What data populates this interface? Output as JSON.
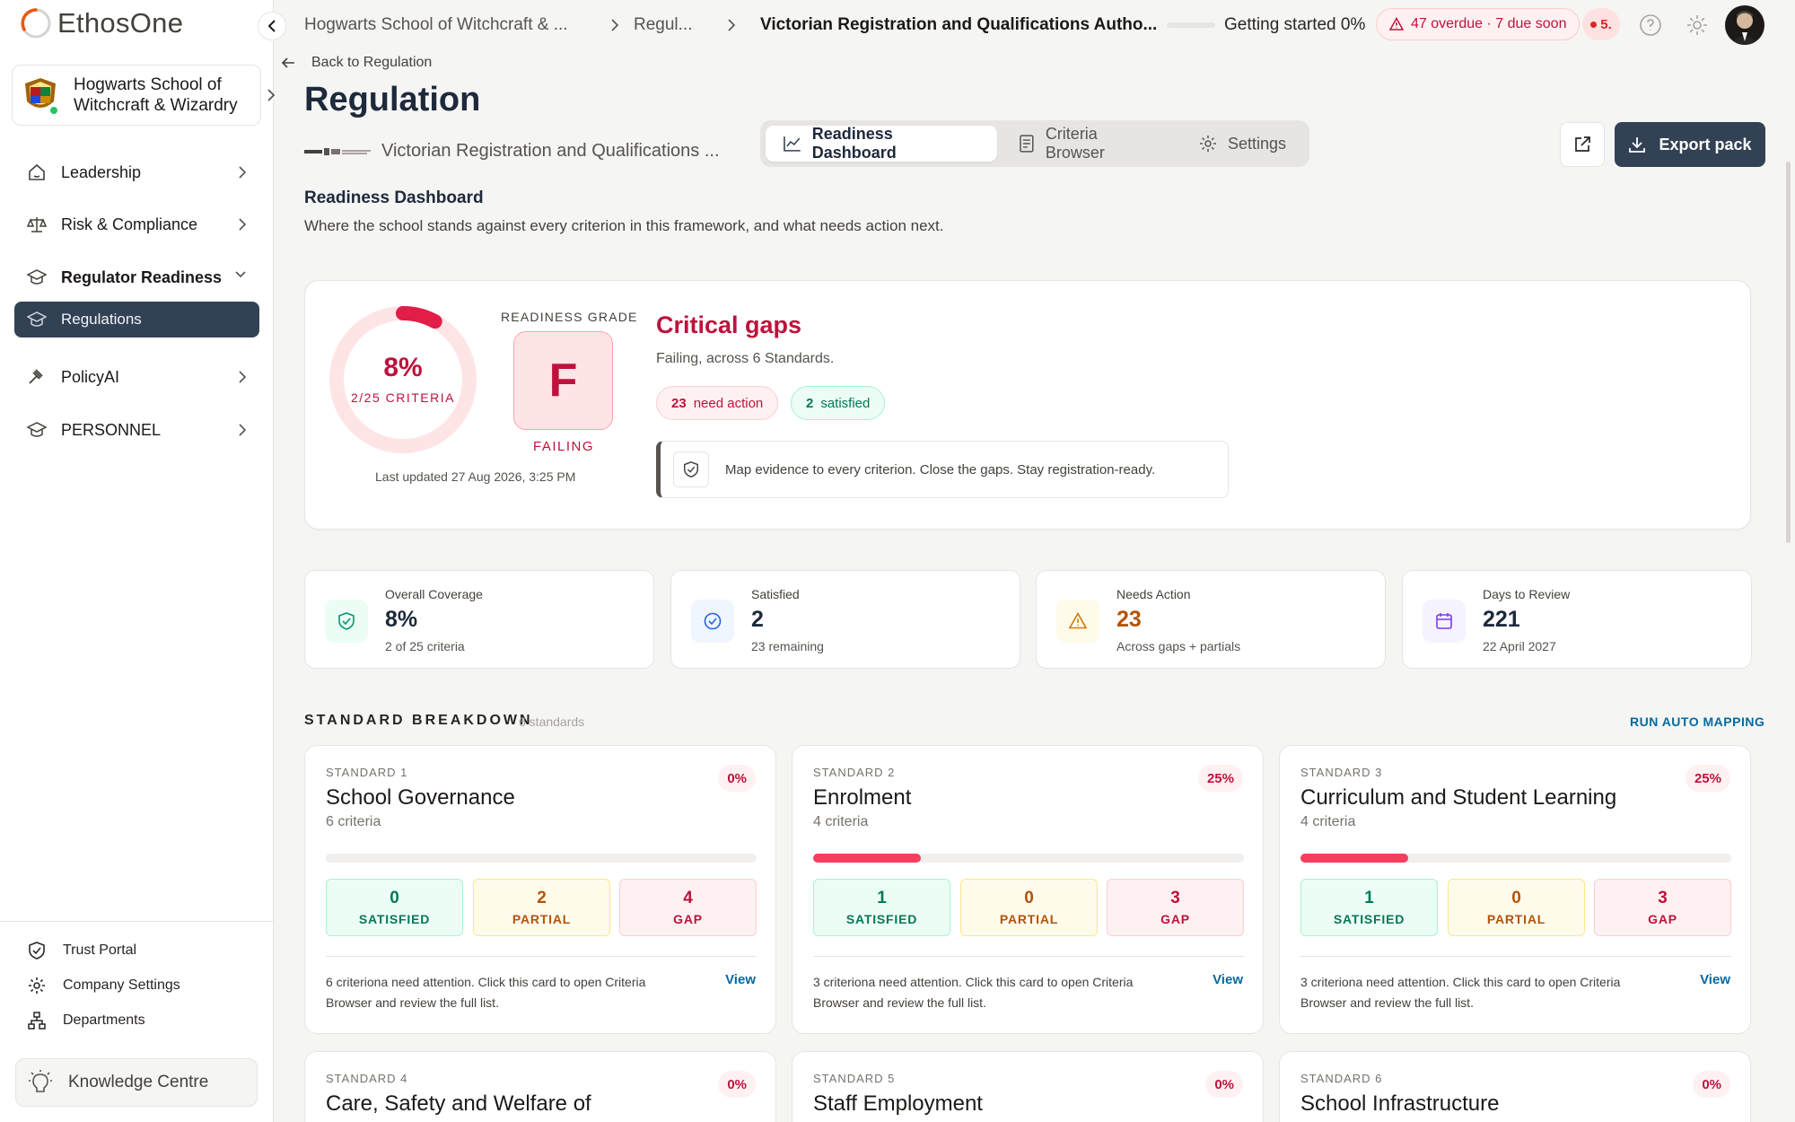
{
  "app": {
    "logo_text": "EthosOne"
  },
  "sidebar": {
    "org_name_line1": "Hogwarts School of",
    "org_name_line2": "Witchcraft & Wizardry",
    "items": [
      {
        "label": "Leadership",
        "icon": "house-icon"
      },
      {
        "label": "Risk & Compliance",
        "icon": "scales-icon"
      },
      {
        "label": "Regulator Readiness",
        "icon": "graduation-cap-icon"
      },
      {
        "label": "Regulations",
        "icon": "graduation-cap-icon"
      },
      {
        "label": "PolicyAI",
        "icon": "gavel-icon"
      },
      {
        "label": "PERSONNEL",
        "icon": "graduation-cap-icon"
      }
    ],
    "footer": [
      {
        "label": "Trust Portal",
        "icon": "shield-check-icon"
      },
      {
        "label": "Company Settings",
        "icon": "gear-icon"
      },
      {
        "label": "Departments",
        "icon": "org-chart-icon"
      }
    ],
    "knowledge_centre": "Knowledge Centre"
  },
  "topbar": {
    "crumb1": "Hogwarts School of Witchcraft & ...",
    "crumb2": "Regul...",
    "crumb3": "Victorian Registration and Qualifications Autho...",
    "getting_started": "Getting started 0%",
    "overdue": "47 overdue · 7 due soon",
    "alerts": "5."
  },
  "header": {
    "back": "Back to Regulation",
    "title": "Regulation",
    "regulator": "Victorian Registration and Qualifications ...",
    "tabs": [
      "Readiness Dashboard",
      "Criteria Browser",
      "Settings"
    ],
    "export": "Export pack"
  },
  "readiness": {
    "title": "Readiness Dashboard",
    "description": "Where the school stands against every criterion in this framework, and what needs action next.",
    "percent": "8%",
    "percent_value": 8,
    "criteria": "2/25 CRITERIA",
    "updated": "Last updated 27 Aug 2026, 3:25 PM",
    "grade_label": "READINESS GRADE",
    "grade": "F",
    "grade_status": "FAILING",
    "headline": "Critical gaps",
    "subline": "Failing, across 6 Standards.",
    "need_action_count": "23",
    "need_action_label": "need action",
    "satisfied_count": "2",
    "satisfied_label": "satisfied",
    "tagline": "Map evidence to every criterion. Close the gaps. Stay registration-ready."
  },
  "stats": [
    {
      "label": "Overall Coverage",
      "value": "8%",
      "note": "2 of 25 criteria",
      "icon": "shield-check-icon"
    },
    {
      "label": "Satisfied",
      "value": "2",
      "note": "23 remaining",
      "icon": "check-circle-icon"
    },
    {
      "label": "Needs Action",
      "value": "23",
      "note": "Across gaps + partials",
      "icon": "warning-icon"
    },
    {
      "label": "Days to Review",
      "value": "221",
      "note": "22 April 2027",
      "icon": "calendar-icon"
    }
  ],
  "standards_section": {
    "title": "STANDARD BREAKDOWN",
    "count": "6 standards",
    "run": "RUN AUTO MAPPING",
    "satisfied_label": "SATISFIED",
    "partial_label": "PARTIAL",
    "gap_label": "GAP",
    "view_label": "View"
  },
  "standards": [
    {
      "num": "STANDARD 1",
      "name": "School Governance",
      "criteria": "6 criteria",
      "pct": "0%",
      "progress": 0,
      "satisfied": "0",
      "partial": "2",
      "gap": "4",
      "msg": "6 criteriona need attention. Click this card to open Criteria Browser and review the full list."
    },
    {
      "num": "STANDARD 2",
      "name": "Enrolment",
      "criteria": "4 criteria",
      "pct": "25%",
      "progress": 25,
      "satisfied": "1",
      "partial": "0",
      "gap": "3",
      "msg": "3 criteriona need attention. Click this card to open Criteria Browser and review the full list."
    },
    {
      "num": "STANDARD 3",
      "name": "Curriculum and Student Learning",
      "criteria": "4 criteria",
      "pct": "25%",
      "progress": 25,
      "satisfied": "1",
      "partial": "0",
      "gap": "3",
      "msg": "3 criteriona need attention. Click this card to open Criteria Browser and review the full list."
    },
    {
      "num": "STANDARD 4",
      "name": "Care, Safety and Welfare of",
      "pct": "0%"
    },
    {
      "num": "STANDARD 5",
      "name": "Staff Employment",
      "pct": "0%"
    },
    {
      "num": "STANDARD 6",
      "name": "School Infrastructure",
      "pct": "0%"
    }
  ],
  "colors": {
    "accent": "#334155",
    "danger": "#be123c",
    "success": "#047857",
    "warning": "#b45309",
    "link": "#0369a1"
  }
}
